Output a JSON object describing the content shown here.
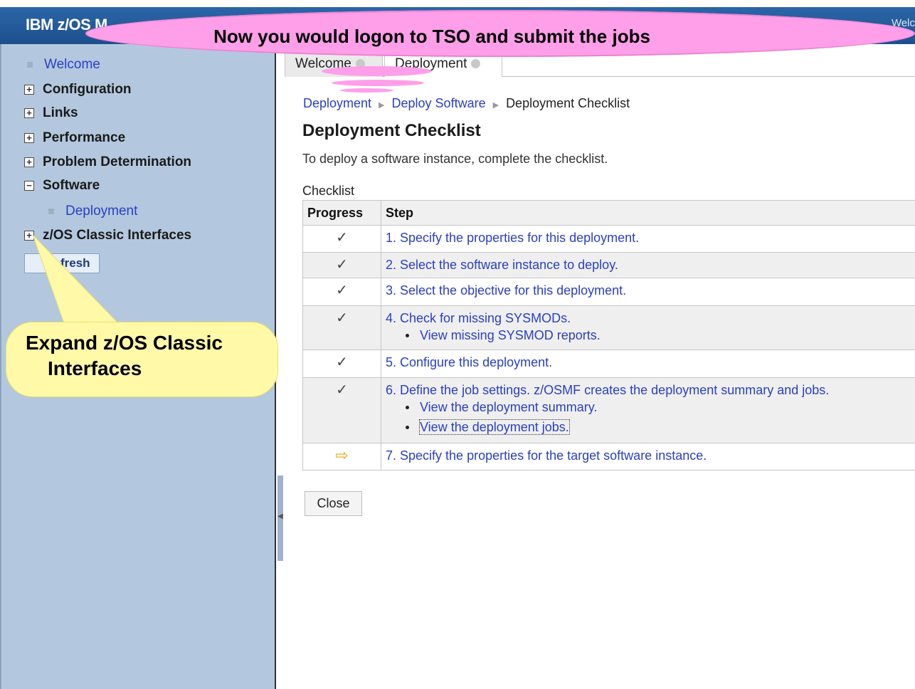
{
  "app": {
    "title": "IBM z/OS M",
    "welcome_partial": "Welc"
  },
  "sidebar": {
    "items": [
      {
        "label": "Welcome",
        "type": "link"
      },
      {
        "label": "Configuration",
        "type": "expand",
        "state": "+"
      },
      {
        "label": "Links",
        "type": "expand",
        "state": "+"
      },
      {
        "label": "Performance",
        "type": "expand",
        "state": "+"
      },
      {
        "label": "Problem Determination",
        "type": "expand",
        "state": "+"
      },
      {
        "label": "Software",
        "type": "expand",
        "state": "−"
      },
      {
        "label": "Deployment",
        "type": "link"
      },
      {
        "label": "z/OS Classic Interfaces",
        "type": "expand",
        "state": "+"
      }
    ],
    "refresh_label": "Refresh",
    "refresh_visible": "fresh"
  },
  "tabs": [
    {
      "label": "Welcome"
    },
    {
      "label": "Deployment"
    }
  ],
  "breadcrumb": [
    "Deployment",
    "Deploy Software",
    "Deployment Checklist"
  ],
  "page": {
    "title": "Deployment Checklist",
    "intro": "To deploy a software instance, complete the checklist.",
    "checklist_caption": "Checklist"
  },
  "table": {
    "headers": [
      "Progress",
      "Step"
    ],
    "rows": [
      {
        "progress": "✓",
        "step": "1. Specify the properties for this deployment.",
        "subs": []
      },
      {
        "progress": "✓",
        "step": "2. Select the software instance to deploy.",
        "subs": []
      },
      {
        "progress": "✓",
        "step": "3. Select the objective for this deployment.",
        "subs": []
      },
      {
        "progress": "✓",
        "step": "4. Check for missing SYSMODs.",
        "subs": [
          "View missing SYSMOD reports."
        ]
      },
      {
        "progress": "✓",
        "step": "5. Configure this deployment.",
        "subs": []
      },
      {
        "progress": "✓",
        "step": "6. Define the job settings. z/OSMF creates the deployment summary and jobs.",
        "subs": [
          "View the deployment summary.",
          "View the deployment jobs."
        ]
      },
      {
        "progress": "⇨",
        "step": "7. Specify the properties for the target software instance.",
        "subs": []
      }
    ]
  },
  "buttons": {
    "close": "Close"
  },
  "callouts": {
    "top": "Now you would logon to TSO and submit the jobs",
    "side_line1": "Expand z/OS Classic",
    "side_line2": "Interfaces"
  },
  "colors": {
    "link": "#2a3fc2",
    "sidebar_bg": "#b3c8de",
    "banner": "#1d4f8d",
    "cloud": "#ff9ee9",
    "note": "#fff9a8",
    "current_arrow": "#f2a900"
  }
}
